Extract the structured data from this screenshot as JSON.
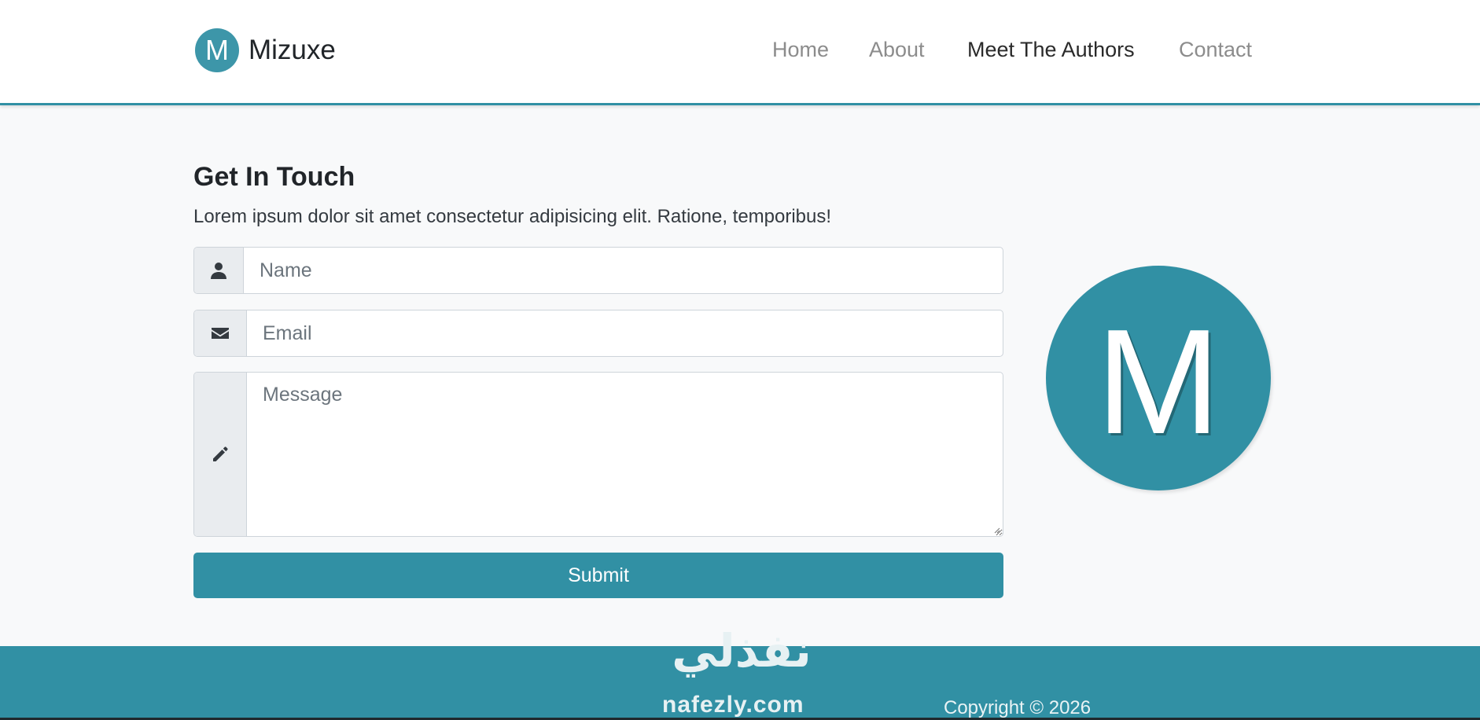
{
  "brand": {
    "logo_letter": "M",
    "name": "Mizuxe"
  },
  "nav": {
    "items": [
      "Home",
      "About",
      "Meet The Authors",
      "Contact"
    ],
    "active": "Meet The Authors"
  },
  "contact": {
    "title": "Get In Touch",
    "lead": "Lorem ipsum dolor sit amet consectetur adipisicing elit. Ratione, temporibus!",
    "name_placeholder": "Name",
    "email_placeholder": "Email",
    "message_placeholder": "Message",
    "submit_label": "Submit",
    "icons": {
      "name": "user-icon",
      "email": "envelope-icon",
      "message": "pencil-icon"
    }
  },
  "side_logo": {
    "letter": "M"
  },
  "footer": {
    "copyright": "Copyright © 2026"
  },
  "watermark": {
    "arabic": "نفذلي",
    "latin": "nafezly.com"
  },
  "colors": {
    "brand": "#3190a4",
    "text": "#212529",
    "muted": "#8c8c8c",
    "background": "#f8f9fa"
  }
}
